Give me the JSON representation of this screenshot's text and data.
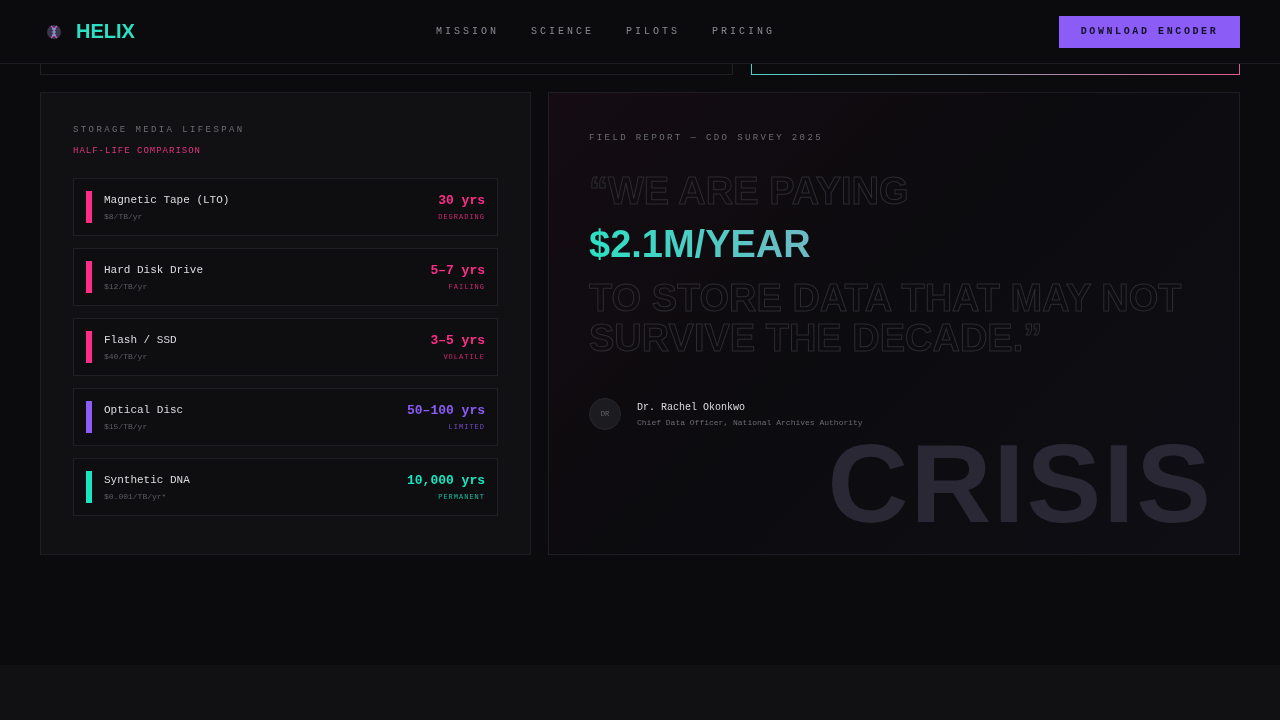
{
  "header": {
    "logo": "HELIX",
    "nav": [
      {
        "label": "MISSION"
      },
      {
        "label": "SCIENCE"
      },
      {
        "label": "PILOTS"
      },
      {
        "label": "PRICING"
      }
    ],
    "cta": "DOWNLOAD ENCODER"
  },
  "lifespan": {
    "eyebrow": "STORAGE MEDIA LIFESPAN",
    "subtitle": "HALF-LIFE COMPARISON",
    "media": [
      {
        "name": "Magnetic Tape (LTO)",
        "cost": "$8/TB/yr",
        "years": "30 yrs",
        "status": "DEGRADING",
        "color": "#ff2d87"
      },
      {
        "name": "Hard Disk Drive",
        "cost": "$12/TB/yr",
        "years": "5–7 yrs",
        "status": "FAILING",
        "color": "#ff2d87"
      },
      {
        "name": "Flash / SSD",
        "cost": "$40/TB/yr",
        "years": "3–5 yrs",
        "status": "VOLATILE",
        "color": "#ff2d87"
      },
      {
        "name": "Optical Disc",
        "cost": "$15/TB/yr",
        "years": "50–100 yrs",
        "status": "LIMITED",
        "color": "#8b5cf6"
      },
      {
        "name": "Synthetic DNA",
        "cost": "$0.001/TB/yr*",
        "years": "10,000 yrs",
        "status": "PERMANENT",
        "color": "#19e6c1"
      }
    ]
  },
  "report": {
    "eyebrow": "FIELD REPORT — CDO SURVEY 2025",
    "quote_lines": [
      {
        "text": "“WE ARE PAYING",
        "kind": "outline"
      },
      {
        "text": "$2.1M/YEAR",
        "kind": "highlight"
      },
      {
        "text": "TO STORE DATA THAT MAY NOT SURVIVE THE DECADE.”",
        "kind": "outline"
      }
    ],
    "author": {
      "initials": "DR",
      "name": "Dr. Rachel Okonkwo",
      "role": "Chief Data Officer, National Archives Authority"
    },
    "background_word": "CRISIS"
  }
}
